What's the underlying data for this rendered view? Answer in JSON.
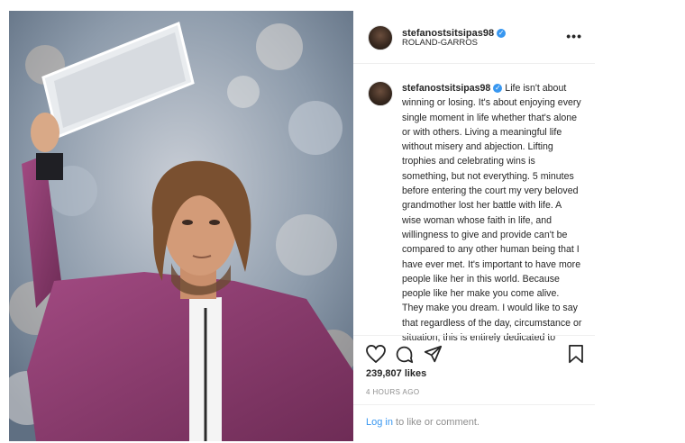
{
  "post": {
    "username": "stefanostsitsipas98",
    "location": "ROLAND-GARROS",
    "more_label": "•••",
    "caption": "Life isn't about winning or losing. It's about enjoying every single moment in life whether that's alone or with others. Living a meaningful life without misery and abjection. Lifting trophies and celebrating wins is something, but not everything. 5 minutes before entering the court my very beloved grandmother lost her battle with life. A wise woman whose faith in life, and willingness to give and provide can't be compared to any other human being that I have ever met. It's important to have more people like her in this world. Because people like her make you come alive. They make you dream. I would like to say that regardless of the day, circumstance or situation, this is entirely dedicated to",
    "likes": "239,807 likes",
    "time": "4 HOURS AGO",
    "login_link": "Log in",
    "login_rest": " to like or comment."
  },
  "colors": {
    "jacket": "#8e3b6e",
    "link": "#3897f0",
    "verified": "#3897f0"
  },
  "icons": [
    "more-icon",
    "heart-icon",
    "comment-icon",
    "share-icon",
    "bookmark-icon",
    "verified-icon"
  ]
}
